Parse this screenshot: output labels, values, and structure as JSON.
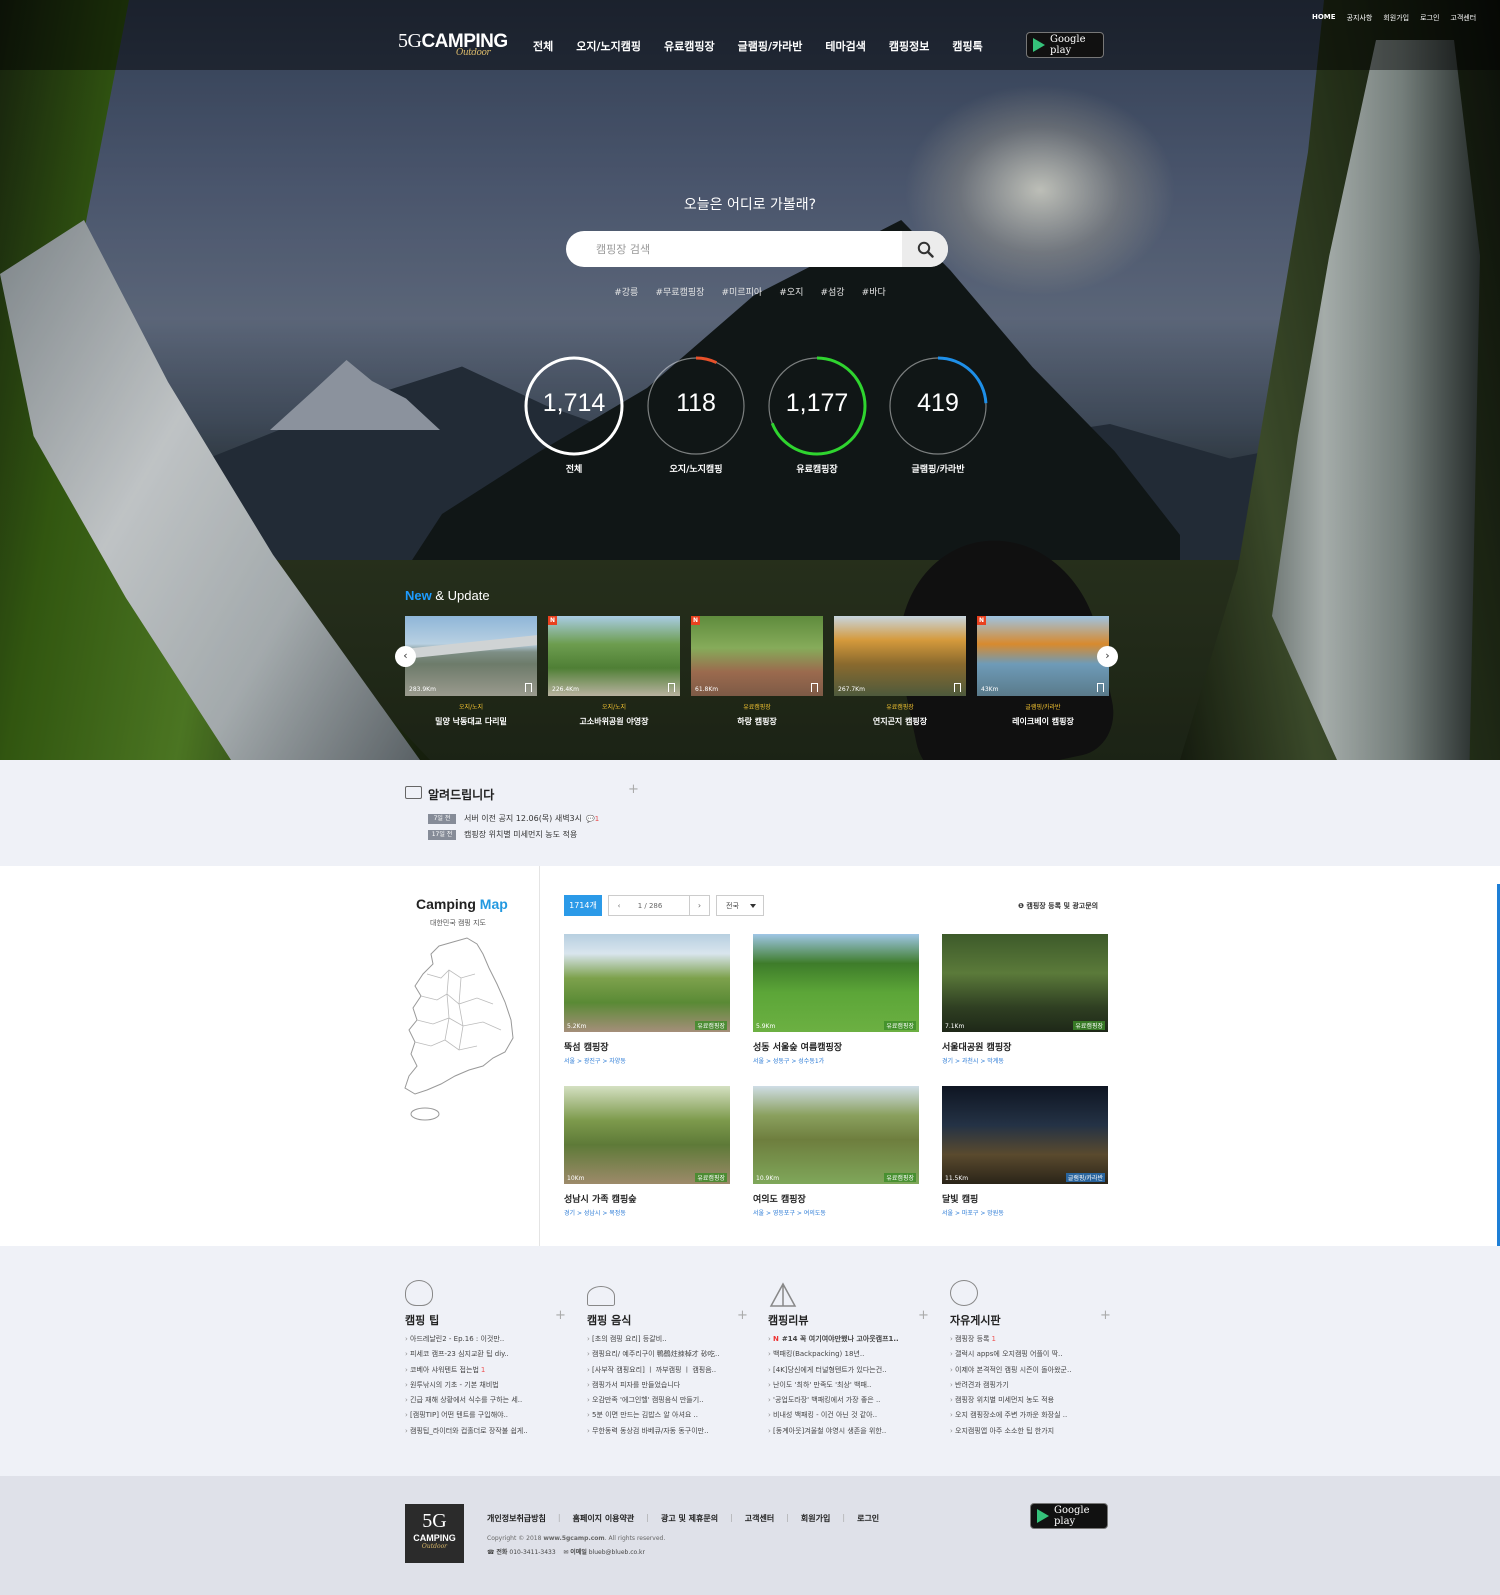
{
  "header": {
    "logo_main": "CAMPING",
    "logo_num": "5G",
    "logo_sub": "Outdoor",
    "nav": [
      "전체",
      "오지/노지캠핑",
      "유료캠핑장",
      "글램핑/카라반",
      "테마검색",
      "캠핑정보",
      "캠핑톡"
    ],
    "google_play_label": "Google play",
    "util": [
      "HOME",
      "공지사항",
      "회원가입",
      "로그인",
      "고객센터"
    ]
  },
  "hero": {
    "headline": "오늘은 어디로 가볼래?",
    "search_placeholder": "캠핑장 검색",
    "tags": [
      "#강릉",
      "#무료캠핑장",
      "#미르피아",
      "#오지",
      "#섬강",
      "#바다"
    ],
    "stats": [
      {
        "value": "1,714",
        "label": "전체",
        "progress": 1.0,
        "color": "#ffffff"
      },
      {
        "value": "118",
        "label": "오지/노지캠핑",
        "progress": 0.07,
        "color": "#e8512a"
      },
      {
        "value": "1,177",
        "label": "유료캠핑장",
        "progress": 0.69,
        "color": "#2fd42f"
      },
      {
        "value": "419",
        "label": "글램핑/카라반",
        "progress": 0.24,
        "color": "#1e8fe8"
      }
    ]
  },
  "new_update": {
    "title_accent": "New",
    "title_rest": " & Update",
    "items": [
      {
        "dist": "283.9Km",
        "category": "오지/노지",
        "name": "밀양 낙동대교 다리밑",
        "new": false
      },
      {
        "dist": "226.4Km",
        "category": "오지/노지",
        "name": "고소바위공원 야영장",
        "new": true
      },
      {
        "dist": "61.8Km",
        "category": "유료캠핑장",
        "name": "하랑 캠핑장",
        "new": true
      },
      {
        "dist": "267.7Km",
        "category": "유료캠핑장",
        "name": "연지곤지 캠핑장",
        "new": false
      },
      {
        "dist": "43Km",
        "category": "글램핑/카라반",
        "name": "레이크베이 캠핑장",
        "new": true
      }
    ],
    "new_badge": "N"
  },
  "notice": {
    "title": "알려드립니다",
    "items": [
      {
        "date": "7일 전",
        "text": "서버 이전 공지 12.06(목) 새벽3시",
        "comments": "1"
      },
      {
        "date": "17일 전",
        "text": "캠핑장 위치별 미세먼지 농도 적용",
        "comments": ""
      }
    ]
  },
  "camping_map": {
    "title_a": "Camping",
    "title_b": "Map",
    "subtitle": "대한민국 캠핑 지도",
    "count": "1714개",
    "page": "1 / 286",
    "region": "전국",
    "ad_link": "캠핑장 등록 및 광고문의",
    "items": [
      {
        "dist": "5.2Km",
        "tag": "유료캠핑장",
        "name": "뚝섬 캠핑장",
        "address": "서울 > 광진구 > 자양동"
      },
      {
        "dist": "5.9Km",
        "tag": "유료캠핑장",
        "name": "성동 서울숲 여름캠핑장",
        "address": "서울 > 성동구 > 성수동1가"
      },
      {
        "dist": "7.1Km",
        "tag": "유료캠핑장",
        "name": "서울대공원 캠핑장",
        "address": "경기 > 과천시 > 막계동"
      },
      {
        "dist": "10Km",
        "tag": "유료캠핑장",
        "name": "성남시 가족 캠핑숲",
        "address": "경기 > 성남시 > 복정동"
      },
      {
        "dist": "10.9Km",
        "tag": "유료캠핑장",
        "name": "여의도 캠핑장",
        "address": "서울 > 영등포구 > 여의도동"
      },
      {
        "dist": "11.5Km",
        "tag": "글램핑/카라반",
        "name": "달빛 캠핑",
        "address": "서울 > 마포구 > 망원동"
      }
    ]
  },
  "boards": [
    {
      "title": "캠핑 팁",
      "items": [
        {
          "t": "아드레날린2 - Ep.16 : 이것만..",
          "n": false,
          "c": ""
        },
        {
          "t": "피세코 캠프-23 심지교환 팁 diy..",
          "n": false,
          "c": ""
        },
        {
          "t": "코베아 샤워텐트 접는법",
          "n": false,
          "c": "1"
        },
        {
          "t": "원투낚시의 기초 - 기본 채비법",
          "n": false,
          "c": ""
        },
        {
          "t": "긴급 재해 상황에서 식수를 구하는 세..",
          "n": false,
          "c": ""
        },
        {
          "t": "[캠핑TIP] 어떤 텐트를 구입해야..",
          "n": false,
          "c": ""
        },
        {
          "t": "캠핑팁_라이터와 컵홀더로 장작불 쉽게..",
          "n": false,
          "c": ""
        }
      ]
    },
    {
      "title": "캠핑 음식",
      "items": [
        {
          "t": "[초의 캠핑 요리] 등갈비..",
          "n": false,
          "c": ""
        },
        {
          "t": "캠핑요리/ 예주리구이 鴨鶴炷拺棹才 砂吃..",
          "n": false,
          "c": ""
        },
        {
          "t": "[사부작 캠핑요리] ㅣ 까부캠핑 ㅣ 캠핑음..",
          "n": false,
          "c": ""
        },
        {
          "t": "캠핑가서 피자를 만들었습니다",
          "n": false,
          "c": ""
        },
        {
          "t": "오감만족 '에그인헬' 캠핑음식 만들기..",
          "n": false,
          "c": ""
        },
        {
          "t": "5분 이면 만드는 김밥스 알 아셔요 ..",
          "n": false,
          "c": ""
        },
        {
          "t": "무한동력 동상검 바베큐/자동 동구이만..",
          "n": false,
          "c": ""
        }
      ]
    },
    {
      "title": "캠핑리뷰",
      "items": [
        {
          "t": "#14 꼭 여기여야만했나 고아웃캠프1..",
          "n": true,
          "c": ""
        },
        {
          "t": "백패킹(Backpacking) 18년..",
          "n": false,
          "c": ""
        },
        {
          "t": "[4K]당신에게 터널형텐트가 있다는건..",
          "n": false,
          "c": ""
        },
        {
          "t": "난이도 '최하' 만족도 '최상' 백패..",
          "n": false,
          "c": ""
        },
        {
          "t": "'공업도라장' 백패킹에서 가장 좋은 ..",
          "n": false,
          "c": ""
        },
        {
          "t": "비내성 백패킹 - 이건 아닌 것 같아..",
          "n": false,
          "c": ""
        },
        {
          "t": "[동계아웃]겨울철 야영시 생존을 위한..",
          "n": false,
          "c": ""
        }
      ]
    },
    {
      "title": "자유게시판",
      "items": [
        {
          "t": "캠핑장 등록",
          "n": false,
          "c": "1"
        },
        {
          "t": "갤럭시 apps에 오지캠핑 어플이 딱..",
          "n": false,
          "c": ""
        },
        {
          "t": "이제야 본격적인 캠핑 시즌이 돌아왔군..",
          "n": false,
          "c": ""
        },
        {
          "t": "반려견과 캠핑가기",
          "n": false,
          "c": ""
        },
        {
          "t": "캠핑장 위치별 미세먼지 농도 적용",
          "n": false,
          "c": ""
        },
        {
          "t": "오지 캠핑장소에 주변 가까운 화장실 ..",
          "n": false,
          "c": ""
        },
        {
          "t": "오지캠핑앱 아주 소소한 팁 한가지",
          "n": false,
          "c": ""
        }
      ]
    }
  ],
  "footer": {
    "links": [
      "개인정보취급방침",
      "홈페이지 이용약관",
      "광고 및 제휴문의",
      "고객센터",
      "회원가입",
      "로그인"
    ],
    "copyright_pre": "Copyright © 2018 ",
    "copyright_site": "www.5gcamp.com",
    "copyright_post": ". All rights reserved.",
    "phone_label": "전화",
    "phone": "010-3411-3433",
    "email_label": "이메일",
    "email": "blueb@blueb.co.kr",
    "google_play_label": "Google play"
  }
}
